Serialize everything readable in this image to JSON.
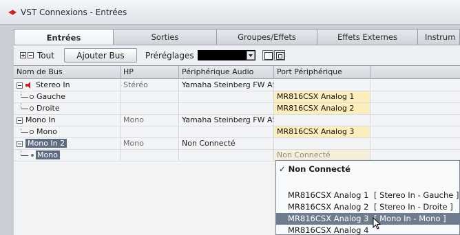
{
  "window": {
    "title": "VST Connexions - Entrées"
  },
  "tabs": [
    "Entrées",
    "Sorties",
    "Groupes/Effets",
    "Effets Externes",
    "Instrum"
  ],
  "toolbar": {
    "expand_all": "Tout",
    "add_bus": "Ajouter Bus",
    "presets_label": "Préréglages"
  },
  "columns": [
    "Nom de Bus",
    "HP",
    "Périphérique Audio",
    "Port Périphérique"
  ],
  "rows": [
    {
      "name": "Stereo In",
      "hp": "Stéréo",
      "device": "Yamaha Steinberg FW AS",
      "port": ""
    },
    {
      "name": "Gauche",
      "hp": "",
      "device": "",
      "port": "MR816CSX Analog 1"
    },
    {
      "name": "Droite",
      "hp": "",
      "device": "",
      "port": "MR816CSX Analog 2"
    },
    {
      "name": "Mono In",
      "hp": "Mono",
      "device": "Yamaha Steinberg FW AS",
      "port": ""
    },
    {
      "name": "Mono",
      "hp": "",
      "device": "",
      "port": "MR816CSX Analog 3"
    },
    {
      "name": "Mono In 2",
      "hp": "Mono",
      "device": "Non Connecté",
      "port": ""
    },
    {
      "name": "Mono",
      "hp": "",
      "device": "",
      "port": "Non Connecté"
    }
  ],
  "dropdown": {
    "not_connected": "Non Connecté",
    "items": [
      {
        "label": "MR816CSX Analog 1",
        "tag": "[ Stereo In - Gauche ]"
      },
      {
        "label": "MR816CSX Analog 2",
        "tag": "[ Stereo In - Droite ]"
      },
      {
        "label": "MR816CSX Analog 3",
        "tag": "[ Mono In - Mono ]"
      },
      {
        "label": "MR816CSX Analog 4",
        "tag": ""
      }
    ]
  },
  "colors": {
    "selection": "#5d6c80",
    "port_highlight": "#fbedbc",
    "brand": "#c01f22"
  }
}
